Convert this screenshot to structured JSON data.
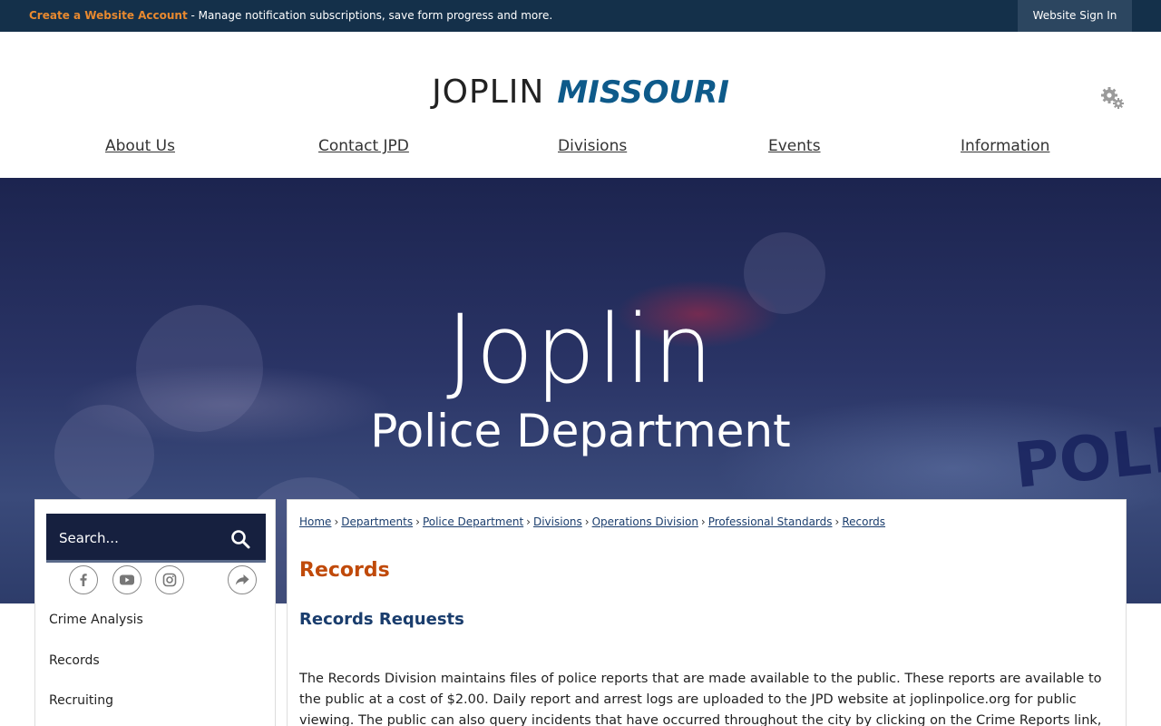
{
  "topbar": {
    "account_link": "Create a Website Account",
    "account_message": " - Manage notification subscriptions, save form progress and more.",
    "signin_label": "Website Sign In"
  },
  "header": {
    "logo_part1": "JOPLIN",
    "logo_part2": "MISSOURI",
    "icon": "gear-icon",
    "nav": [
      {
        "label": "About Us"
      },
      {
        "label": "Contact JPD"
      },
      {
        "label": "Divisions"
      },
      {
        "label": "Events"
      },
      {
        "label": "Information"
      }
    ]
  },
  "hero": {
    "title": "Joplin",
    "subtitle": "Police Department",
    "background_text": "POLI"
  },
  "sidebar": {
    "search_placeholder": "Search...",
    "social_icons": [
      "facebook-icon",
      "youtube-icon",
      "instagram-icon",
      "share-icon"
    ],
    "links": [
      {
        "label": "Crime Analysis"
      },
      {
        "label": "Records"
      },
      {
        "label": "Recruiting"
      }
    ]
  },
  "main": {
    "breadcrumbs": [
      {
        "label": "Home"
      },
      {
        "label": "Departments"
      },
      {
        "label": "Police Department"
      },
      {
        "label": "Divisions"
      },
      {
        "label": "Operations Division"
      },
      {
        "label": "Professional Standards"
      },
      {
        "label": "Records"
      }
    ],
    "breadcrumb_separator": "›",
    "title": "Records",
    "subtitle": "Records Requests",
    "body": "The Records Division maintains files of police reports that are made available to the public. These reports are available to the public at a cost of $2.00. Daily report and arrest logs are uploaded to the JPD website at joplinpolice.org for public viewing. The public can also query incidents that have occurred throughout the city by clicking on the Crime Reports link,"
  },
  "colors": {
    "topbar_bg": "#14304a",
    "account_link": "#e8892f",
    "logo_blue": "#0e5a8a",
    "title_orange": "#c04a0a",
    "link_blue": "#1a3d6d",
    "search_bg": "#16203f"
  }
}
